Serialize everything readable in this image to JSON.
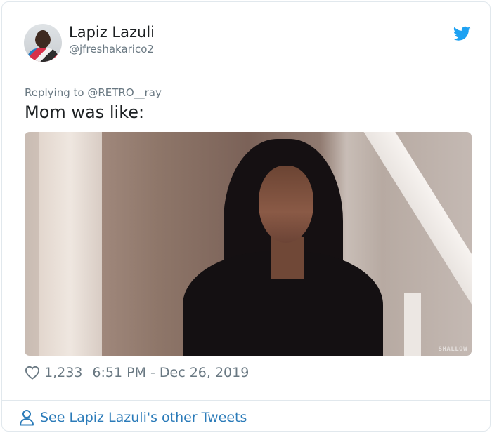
{
  "author": {
    "display_name": "Lapiz Lazuli",
    "handle": "@jfreshakarico2"
  },
  "tweet": {
    "replying_to": "Replying to @RETRO__ray",
    "text": "Mom was like:",
    "media_watermark": "SHALLOW"
  },
  "meta": {
    "likes": "1,233",
    "timestamp": "6:51 PM - Dec 26, 2019"
  },
  "footer": {
    "see_more": "See Lapiz Lazuli's other Tweets"
  },
  "icons": {
    "brand": "twitter-bird-icon",
    "like": "heart-icon",
    "profile": "person-icon"
  },
  "colors": {
    "brand": "#1da1f2",
    "link": "#2b7bb9",
    "muted": "#697882",
    "text": "#1c2022",
    "border": "#e1e8ed"
  }
}
